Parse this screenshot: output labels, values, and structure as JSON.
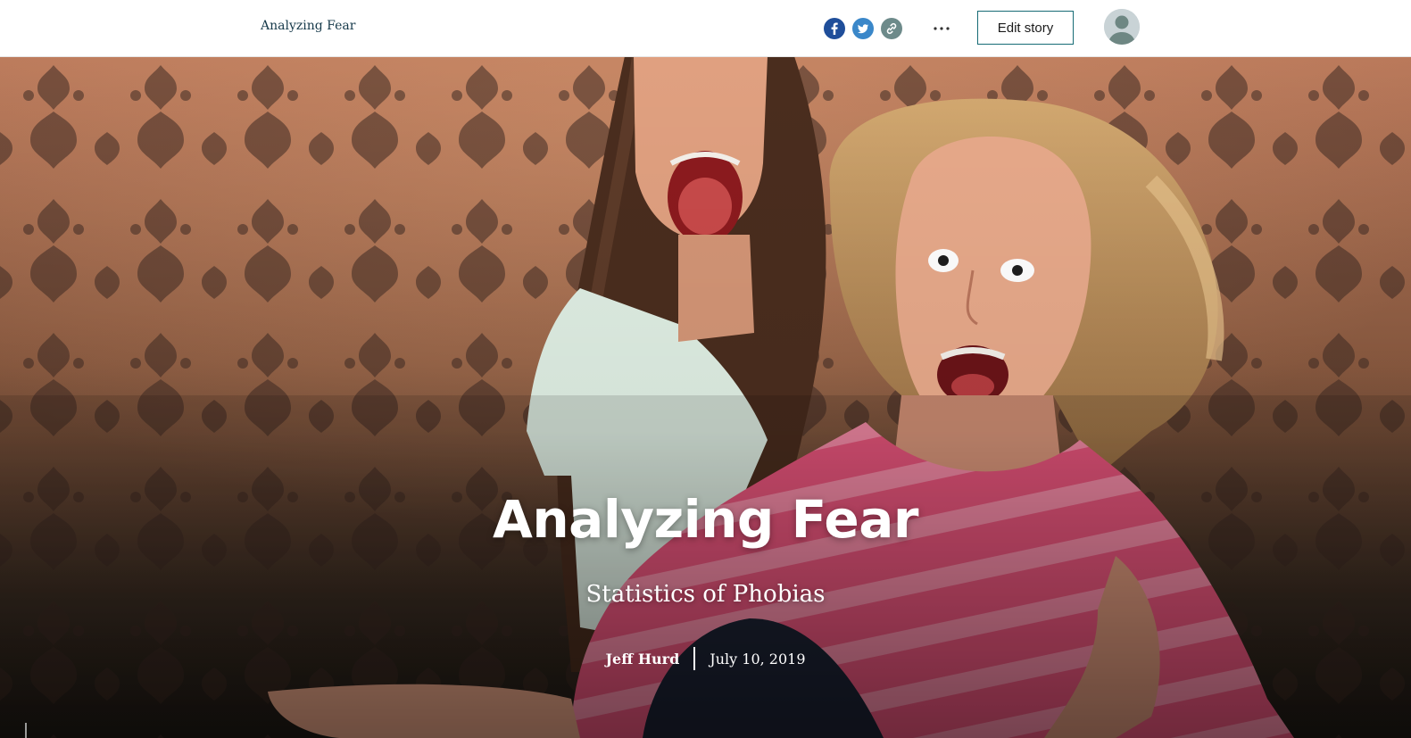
{
  "header": {
    "story_title": "Analyzing Fear",
    "share_icons": [
      "facebook-icon",
      "twitter-icon",
      "link-icon"
    ],
    "more_icon": "more-horizontal-icon",
    "edit_label": "Edit story",
    "avatar_icon": "user-avatar-icon"
  },
  "hero": {
    "title": "Analyzing Fear",
    "subtitle": "Statistics of Phobias",
    "author": "Jeff Hurd",
    "date": "July 10, 2019",
    "scroll_icon": "arrow-down-icon"
  },
  "colors": {
    "accent": "#166b75",
    "facebook": "#1f4e9a",
    "twitter": "#3a87c9",
    "link": "#6d8a8a",
    "title_text": "#16394a"
  }
}
